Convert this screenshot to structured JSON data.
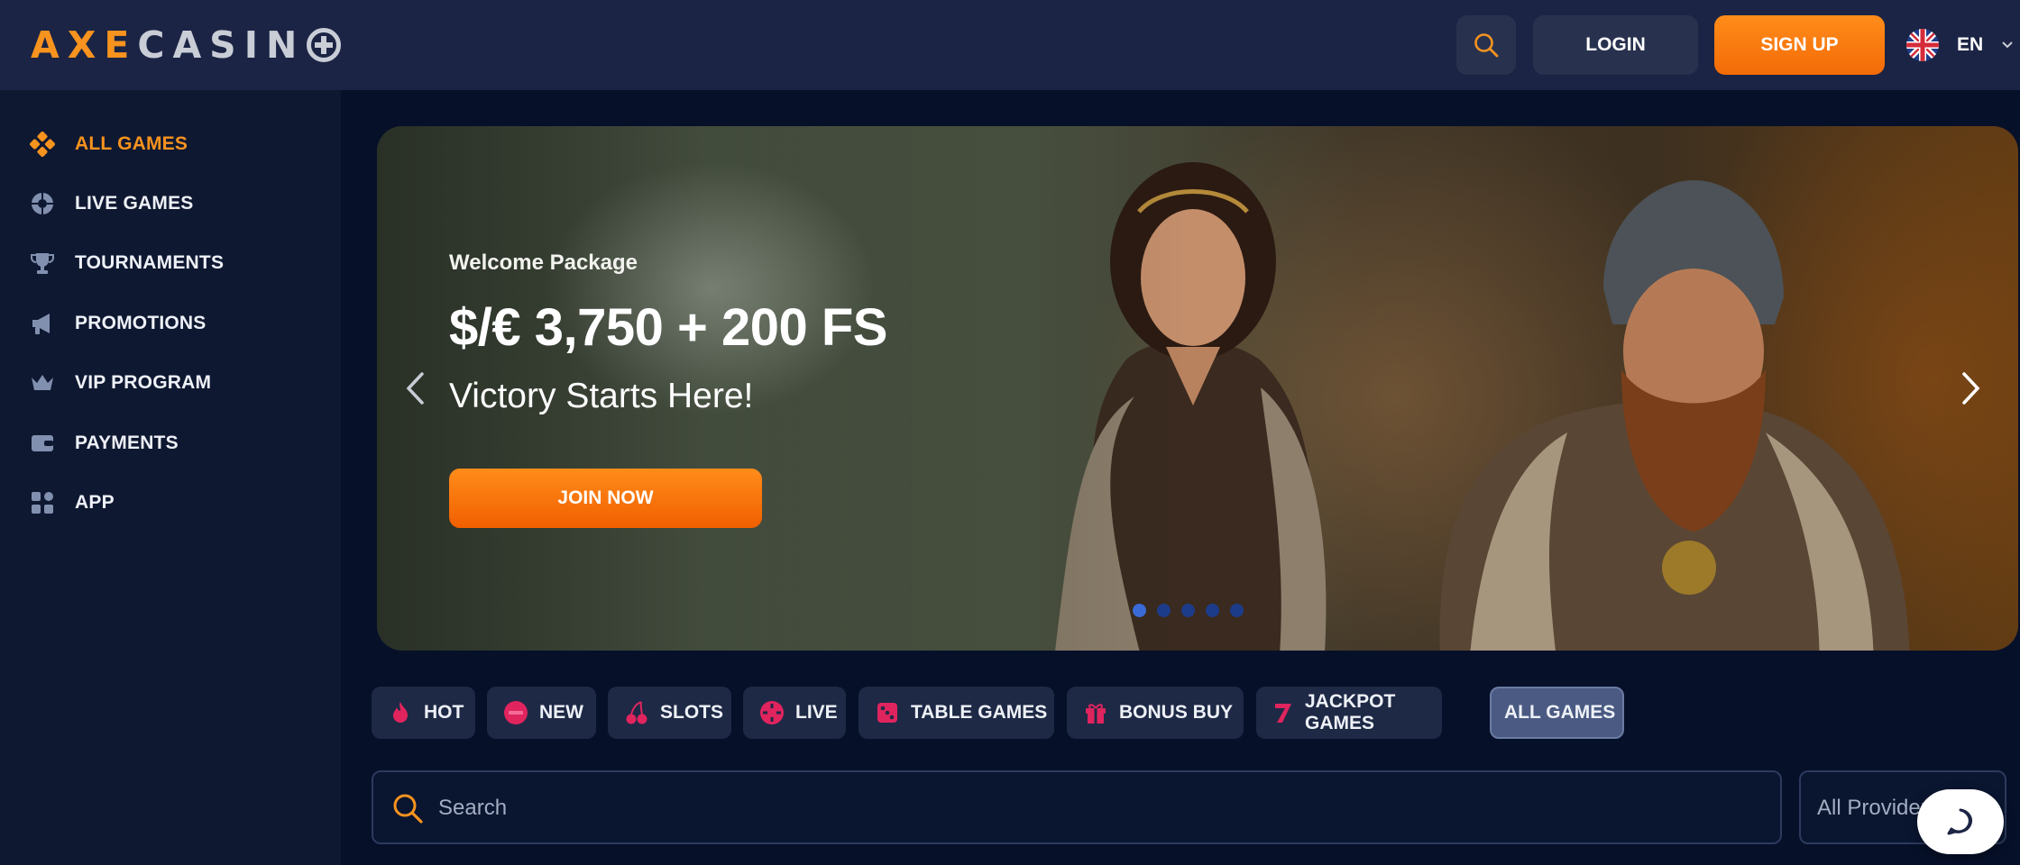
{
  "brand": {
    "logo_part1": "AXE",
    "logo_part2": "CASIN"
  },
  "header": {
    "search_icon": "search-icon",
    "login_label": "LOGIN",
    "signup_label": "SIGN UP",
    "language": {
      "flag": "uk-flag-icon",
      "code": "EN"
    }
  },
  "sidebar": {
    "items": [
      {
        "label": "ALL GAMES",
        "icon": "dice-icon",
        "active": true
      },
      {
        "label": "LIVE GAMES",
        "icon": "roulette-icon",
        "active": false
      },
      {
        "label": "TOURNAMENTS",
        "icon": "trophy-icon",
        "active": false
      },
      {
        "label": "PROMOTIONS",
        "icon": "megaphone-icon",
        "active": false
      },
      {
        "label": "VIP PROGRAM",
        "icon": "crown-icon",
        "active": false
      },
      {
        "label": "PAYMENTS",
        "icon": "wallet-icon",
        "active": false
      },
      {
        "label": "APP",
        "icon": "apps-icon",
        "active": false
      }
    ]
  },
  "banner": {
    "kicker": "Welcome Package",
    "amount": "$/€ 3,750 + 200 FS",
    "tagline": "Victory Starts Here!",
    "cta_label": "JOIN NOW",
    "slides_total": 5,
    "active_slide": 1
  },
  "categories": [
    {
      "label": "HOT",
      "icon": "fire-icon",
      "selected": false
    },
    {
      "label": "NEW",
      "icon": "new-badge-icon",
      "selected": false
    },
    {
      "label": "SLOTS",
      "icon": "cherry-icon",
      "selected": false
    },
    {
      "label": "LIVE",
      "icon": "live-chip-icon",
      "selected": false
    },
    {
      "label": "TABLE GAMES",
      "icon": "dice-icon",
      "selected": false
    },
    {
      "label": "BONUS BUY",
      "icon": "gift-icon",
      "selected": false
    },
    {
      "label": "JACKPOT GAMES",
      "icon": "seven-icon",
      "selected": false
    },
    {
      "label": "ALL GAMES",
      "icon": "",
      "selected": true
    }
  ],
  "search": {
    "placeholder": "Search"
  },
  "provider_filter": {
    "selected": "All Providers"
  },
  "colors": {
    "accent": "#f7931e",
    "background": "#061029",
    "header": "#1b2444",
    "category_icon": "#e0245e"
  }
}
